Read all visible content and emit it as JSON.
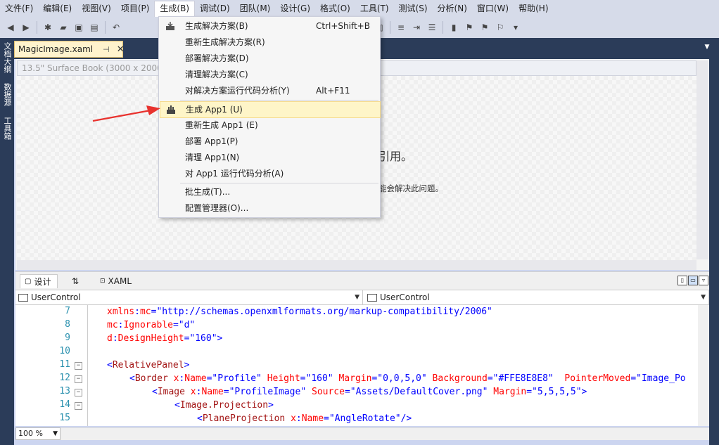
{
  "menubar": [
    "文件(F)",
    "编辑(E)",
    "视图(V)",
    "项目(P)",
    "生成(B)",
    "调试(D)",
    "团队(M)",
    "设计(G)",
    "格式(O)",
    "工具(T)",
    "测试(S)",
    "分析(N)",
    "窗口(W)",
    "帮助(H)"
  ],
  "left_tabs": [
    "文档大纲",
    "数据源",
    "工具箱"
  ],
  "doc_tab": {
    "title": "MagicImage.xaml",
    "pin": "⊣",
    "close": "✕"
  },
  "designer": {
    "device": "13.5\" Surface Book (3000 x 2000) 200% scale",
    "message1": "引用。",
    "message2": "能会解决此问题。"
  },
  "build_menu": {
    "group1": [
      {
        "label": "生成解决方案(B)",
        "shortcut": "Ctrl+Shift+B",
        "icon": "build-solution-icon"
      },
      {
        "label": "重新生成解决方案(R)",
        "shortcut": ""
      },
      {
        "label": "部署解决方案(D)",
        "shortcut": ""
      },
      {
        "label": "清理解决方案(C)",
        "shortcut": ""
      },
      {
        "label": "对解决方案运行代码分析(Y)",
        "shortcut": "Alt+F11"
      }
    ],
    "group2": [
      {
        "label": "生成 App1 (U)",
        "icon": "build-project-icon",
        "highlighted": true
      },
      {
        "label": "重新生成 App1 (E)"
      },
      {
        "label": "部署 App1(P)"
      },
      {
        "label": "清理 App1(N)"
      },
      {
        "label": "对 App1 运行代码分析(A)"
      }
    ],
    "group3": [
      {
        "label": "批生成(T)..."
      },
      {
        "label": "配置管理器(O)..."
      }
    ]
  },
  "split": {
    "design_tab": "设计",
    "swap": "⇅",
    "xaml_tab": "XAML"
  },
  "selectors": {
    "left": "UserControl",
    "right": "UserControl"
  },
  "code": {
    "lines": [
      {
        "n": "7",
        "fold": false
      },
      {
        "n": "8",
        "fold": false
      },
      {
        "n": "9",
        "fold": false
      },
      {
        "n": "10",
        "fold": false
      },
      {
        "n": "11",
        "fold": true
      },
      {
        "n": "12",
        "fold": true
      },
      {
        "n": "13",
        "fold": true
      },
      {
        "n": "14",
        "fold": true
      },
      {
        "n": "15",
        "fold": false
      }
    ]
  },
  "zoom": "100 %",
  "colors": {
    "accent_dark": "#2b3c59",
    "menu_highlight": "#fef5c8",
    "arrow": "#e8322e"
  }
}
